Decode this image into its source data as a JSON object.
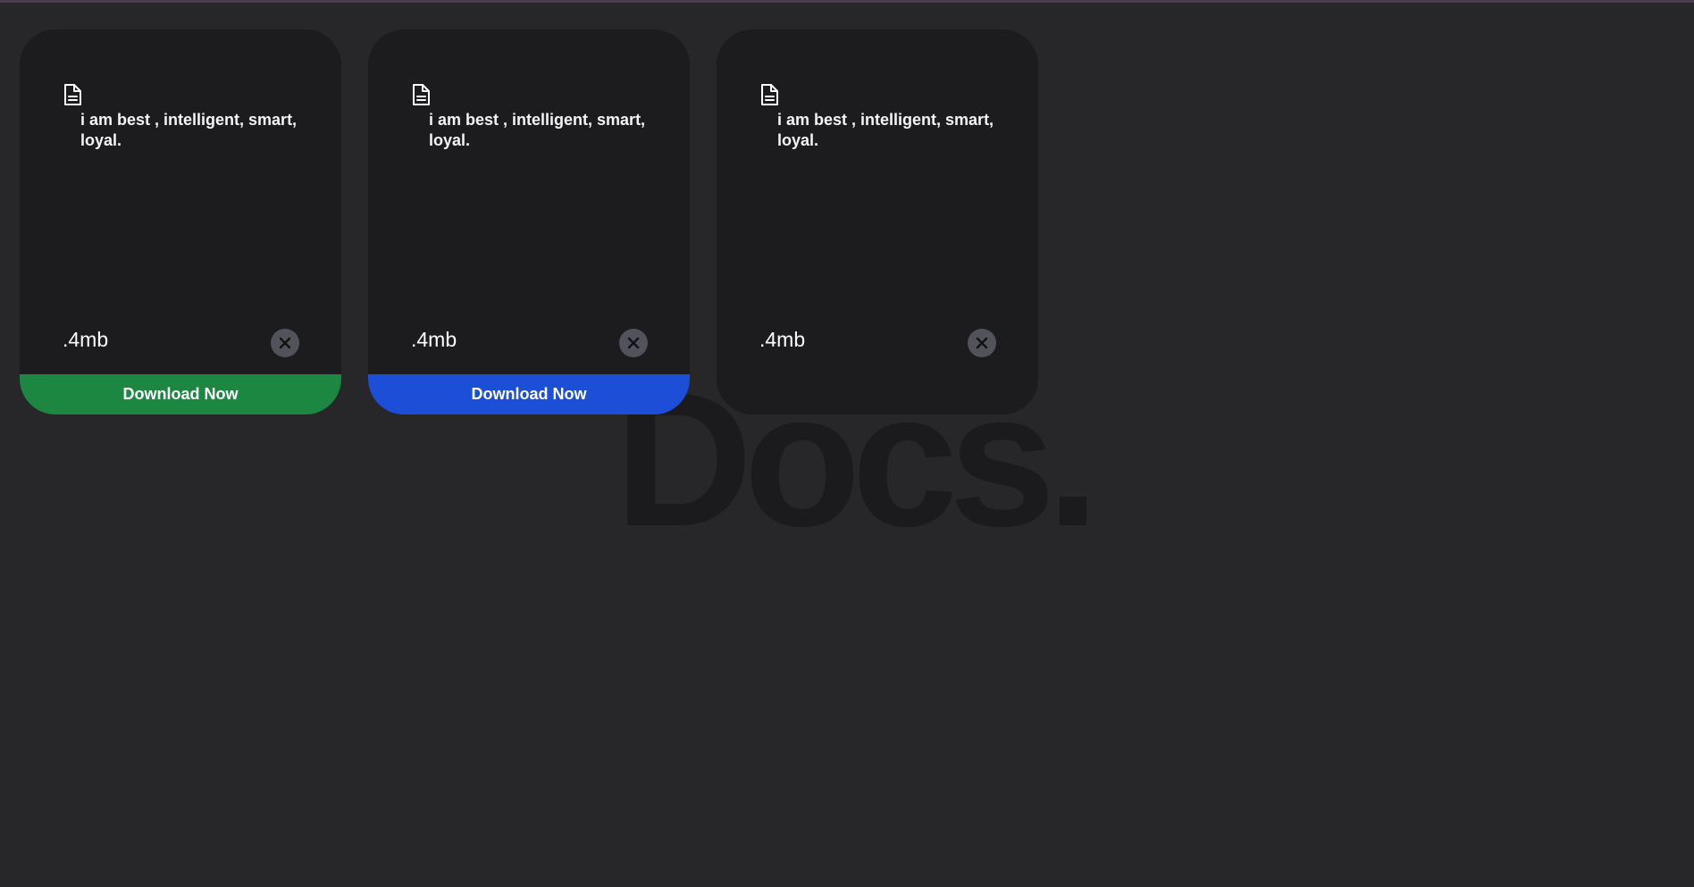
{
  "background_title": "Docs.",
  "colors": {
    "page_background": "#27272a",
    "card_background": "#1c1c1f",
    "close_button_background": "#52525b",
    "text": "#ffffff",
    "background_title": "#1b1b1e"
  },
  "cards": [
    {
      "icon": "document-icon",
      "description": "i am best , intelligent, smart, loyal.",
      "file_size": ".4mb",
      "close_icon": "close-icon",
      "download": {
        "label": "Download Now",
        "color": "#1b8741"
      }
    },
    {
      "icon": "document-icon",
      "description": "i am best , intelligent, smart, loyal.",
      "file_size": ".4mb",
      "close_icon": "close-icon",
      "download": {
        "label": "Download Now",
        "color": "#1d4ed8"
      }
    },
    {
      "icon": "document-icon",
      "description": "i am best , intelligent, smart, loyal.",
      "file_size": ".4mb",
      "close_icon": "close-icon"
    }
  ]
}
